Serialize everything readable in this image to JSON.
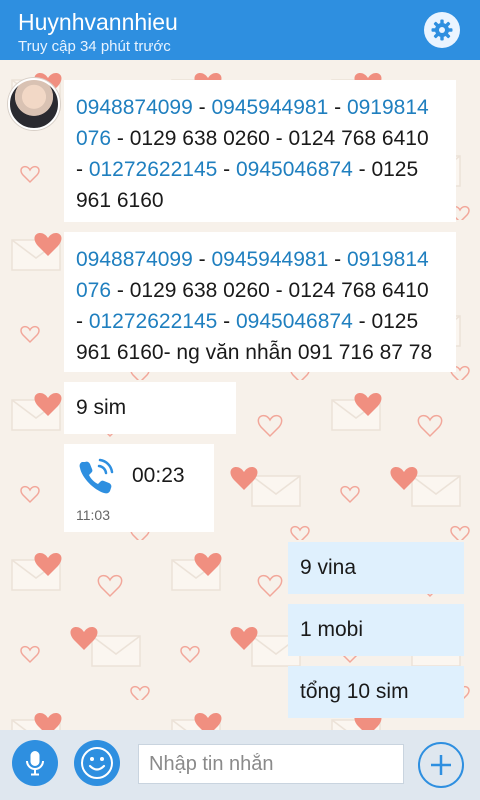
{
  "header": {
    "title": "Huynhvannhieu",
    "subtitle": "Truy cập 34 phút trước"
  },
  "messages": [
    {
      "direction": "incoming",
      "lines": [
        [
          "0948874099",
          " - ",
          "0945944981",
          " - ",
          "0919814"
        ],
        [
          "076",
          " - 0129 638 0260 - 0124 768 6410"
        ],
        [
          "- ",
          "01272622145",
          " - ",
          "0945046874",
          " - 0125"
        ],
        [
          "961 6160"
        ]
      ]
    },
    {
      "direction": "incoming",
      "lines": [
        [
          "0948874099",
          " - ",
          "0945944981",
          " - ",
          "0919814"
        ],
        [
          "076",
          " - 0129 638 0260 - 0124 768 6410"
        ],
        [
          "- ",
          "01272622145",
          " - ",
          "0945046874",
          " - 0125"
        ],
        [
          "961 6160- ng văn nhẫn 091 716 87 78"
        ]
      ]
    },
    {
      "direction": "incoming",
      "text": "9 sim"
    },
    {
      "direction": "incoming",
      "type": "call",
      "duration": "00:23",
      "time": "11:03"
    },
    {
      "direction": "outgoing",
      "text": "9 vina"
    },
    {
      "direction": "outgoing",
      "text": "1 mobi"
    },
    {
      "direction": "outgoing",
      "text": "tổng 10 sim"
    }
  ],
  "composer": {
    "placeholder": "Nhập tin nhắn"
  },
  "colors": {
    "accent": "#2e8fe0",
    "link": "#1f7fbf",
    "outgoing_bubble": "#dff0fd",
    "incoming_bubble": "#ffffff",
    "heart": "#f08f80"
  },
  "icons": [
    "settings-gear-icon",
    "phone-call-icon",
    "microphone-icon",
    "smiley-icon",
    "add-plus-icon"
  ]
}
